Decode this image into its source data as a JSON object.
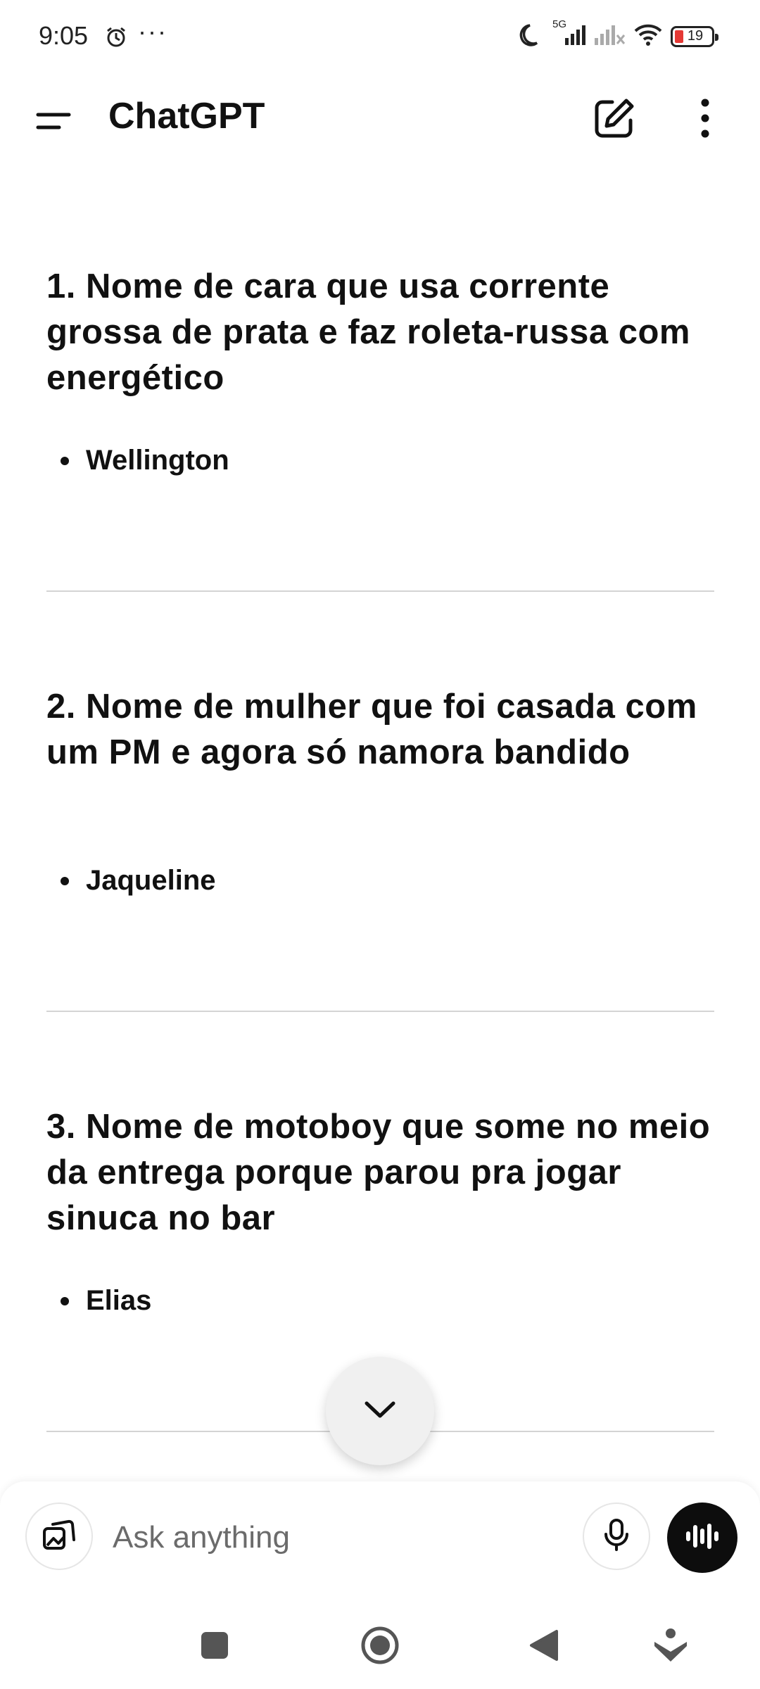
{
  "status_bar": {
    "time": "9:05",
    "dots": "···",
    "network": "5G",
    "battery": "19",
    "icons": [
      "alarm-icon",
      "moon-icon",
      "signal-icon",
      "signal-off-icon",
      "wifi-icon",
      "battery-icon"
    ]
  },
  "app_bar": {
    "title": "ChatGPT",
    "icons": [
      "menu-icon",
      "compose-icon",
      "more-vert-icon"
    ]
  },
  "sections": [
    {
      "heading": "1. Nome de cara que usa corrente grossa de prata e faz roleta-russa com energético",
      "answer": "Wellington"
    },
    {
      "heading": "2. Nome de mulher que foi casada com um PM e agora só namora bandido",
      "answer": "Jaqueline"
    },
    {
      "heading": "3. Nome de motoboy que some no meio da entrega porque parou pra jogar sinuca no bar",
      "answer": "Elias"
    }
  ],
  "composer": {
    "placeholder": "Ask anything",
    "value": "",
    "icons": [
      "attach-image-icon",
      "mic-icon",
      "voice-mode-icon"
    ]
  },
  "scroll_button": {
    "icon": "chevron-down-icon"
  },
  "nav_bar": {
    "icons": [
      "recents-square-icon",
      "home-circle-icon",
      "back-triangle-icon",
      "assistant-icon"
    ]
  },
  "colors": {
    "accent": "#0d0d0d",
    "divider": "#d4d4d4",
    "battery_low": "#e53935",
    "fab_bg": "#f0f0f0"
  }
}
